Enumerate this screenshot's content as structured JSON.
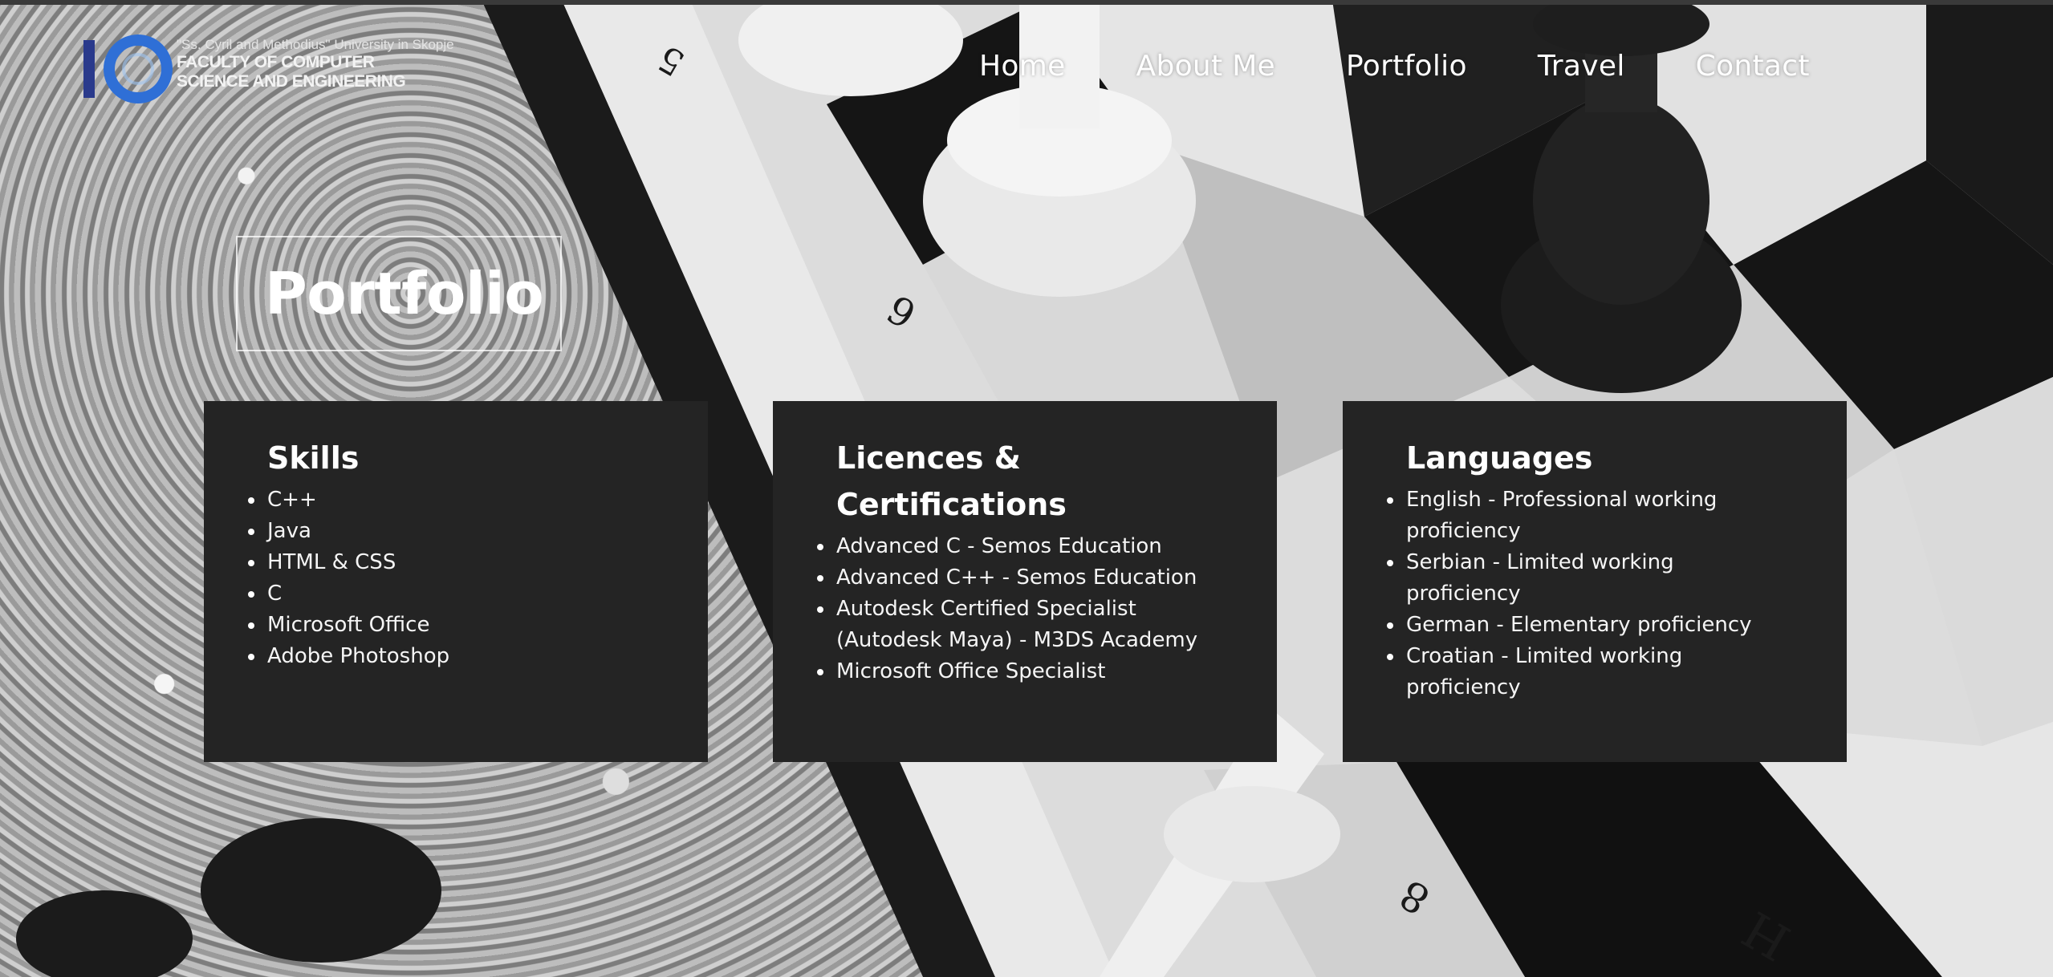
{
  "logo": {
    "line1": "\"Ss. Cyril and Methodius\" University in Skopje",
    "line2": "FACULTY OF COMPUTER",
    "line3": "SCIENCE AND ENGINEERING"
  },
  "nav": {
    "items": [
      {
        "label": "Home"
      },
      {
        "label": "About Me"
      },
      {
        "label": "Portfolio"
      },
      {
        "label": "Travel"
      },
      {
        "label": "Contact"
      }
    ]
  },
  "page_title": "Portfolio",
  "cards": {
    "skills": {
      "title": "Skills",
      "items": [
        "C++",
        "Java",
        "HTML & CSS",
        "C",
        "Microsoft Office",
        "Adobe Photoshop"
      ]
    },
    "licences": {
      "title_line1": "Licences &",
      "title_line2": "Certifications",
      "items": [
        "Advanced C - Semos Education",
        "Advanced C++ - Semos Education",
        "Autodesk Certified Specialist",
        "(Autodesk Maya) - M3DS Academy",
        "Microsoft Office Specialist"
      ]
    },
    "languages": {
      "title": "Languages",
      "items": [
        "English - Professional working",
        "proficiency",
        "Serbian - Limited working",
        "proficiency",
        "German - Elementary proficiency",
        "Croatian - Limited working",
        "proficiency"
      ]
    }
  },
  "colors": {
    "card_background": "#242424",
    "text": "#ffffff",
    "logo_blue": "#2f6fd6"
  },
  "icons": {
    "logo": "fcse-logo-icon"
  }
}
